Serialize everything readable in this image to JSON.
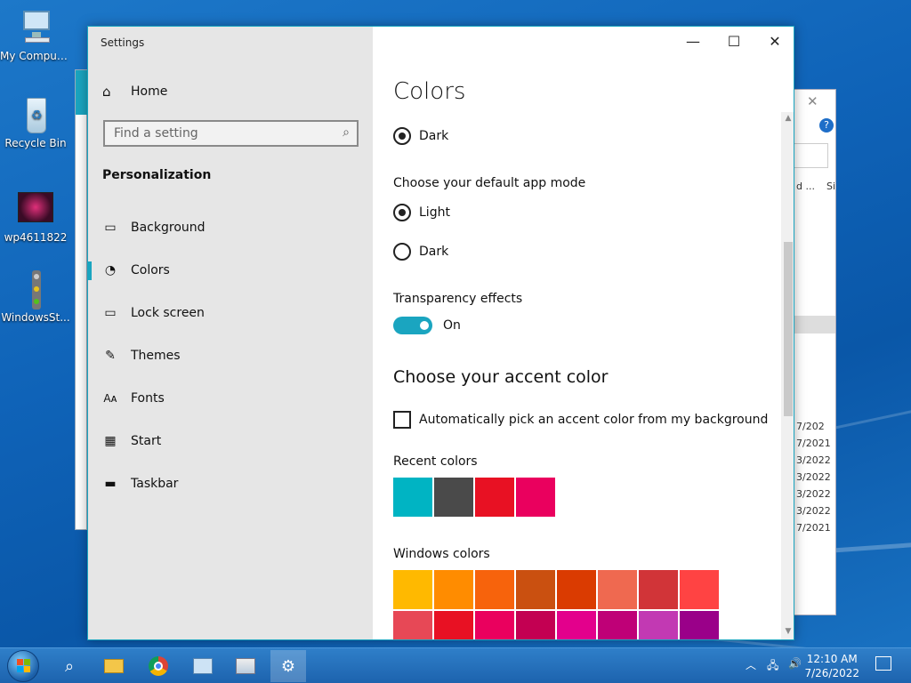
{
  "desktop": {
    "icons": [
      {
        "label": "My Computer",
        "icon": "computer-icon"
      },
      {
        "label": "Recycle Bin",
        "icon": "recycle-bin-icon"
      },
      {
        "label": "wp4611822",
        "icon": "image-file-icon"
      },
      {
        "label": "WindowsSt...",
        "icon": "traffic-light-icon"
      }
    ]
  },
  "background_window": {
    "rows": [
      "d ...",
      "Si",
      "7/202",
      "7/2021",
      "3/2022",
      "3/2022",
      "3/2022",
      "3/2022",
      "7/2021"
    ]
  },
  "settings": {
    "title": "Settings",
    "sidebar": {
      "home_label": "Home",
      "search_placeholder": "Find a setting",
      "section": "Personalization",
      "items": [
        {
          "label": "Background",
          "icon": "picture-icon"
        },
        {
          "label": "Colors",
          "icon": "palette-icon",
          "active": true
        },
        {
          "label": "Lock screen",
          "icon": "lock-screen-icon"
        },
        {
          "label": "Themes",
          "icon": "themes-icon"
        },
        {
          "label": "Fonts",
          "icon": "fonts-icon"
        },
        {
          "label": "Start",
          "icon": "start-icon"
        },
        {
          "label": "Taskbar",
          "icon": "taskbar-icon"
        }
      ]
    },
    "content": {
      "page_title": "Colors",
      "windows_mode_selected": "Dark",
      "app_mode_heading": "Choose your default app mode",
      "app_mode_options": [
        {
          "label": "Light",
          "selected": true
        },
        {
          "label": "Dark",
          "selected": false
        }
      ],
      "transparency_heading": "Transparency effects",
      "transparency_state": "On",
      "accent_heading": "Choose your accent color",
      "auto_accent_label": "Automatically pick an accent color from my background",
      "auto_accent_checked": false,
      "recent_colors_label": "Recent colors",
      "recent_colors": [
        "#00b4c3",
        "#4a4a4a",
        "#e81123",
        "#ea005e"
      ],
      "windows_colors_label": "Windows colors",
      "windows_colors": [
        "#ffb900",
        "#ff8c00",
        "#f7630c",
        "#ca5010",
        "#da3b01",
        "#ef6950",
        "#d13438",
        "#ff4343",
        "#e74856",
        "#e81123",
        "#ea005e",
        "#c30052",
        "#e3008c",
        "#bf0077",
        "#c239b3",
        "#9a0089"
      ]
    }
  },
  "taskbar": {
    "clock_time": "12:10 AM",
    "clock_date": "7/26/2022",
    "accent": "#1aa5c0"
  }
}
